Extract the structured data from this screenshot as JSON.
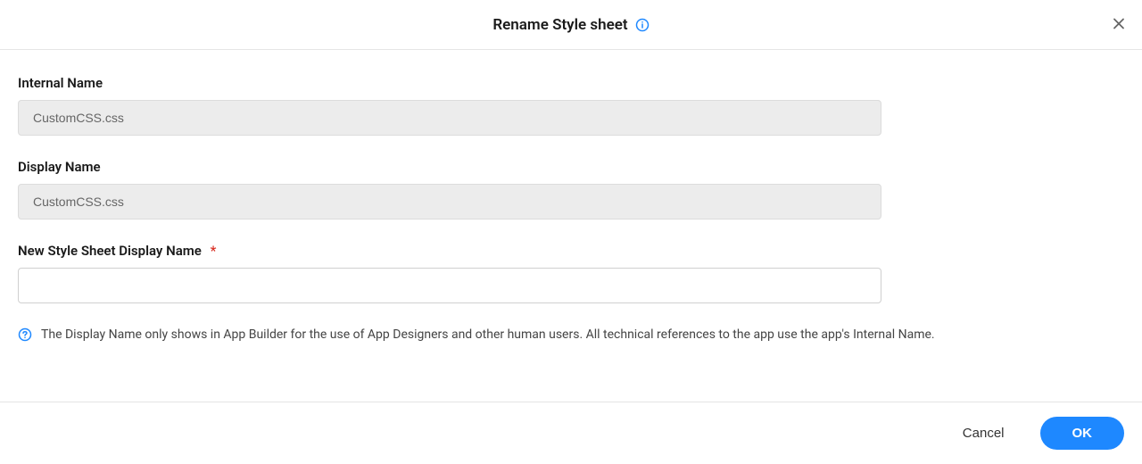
{
  "header": {
    "title": "Rename Style sheet"
  },
  "form": {
    "internal_name": {
      "label": "Internal Name",
      "value": "CustomCSS.css"
    },
    "display_name": {
      "label": "Display Name",
      "value": "CustomCSS.css"
    },
    "new_display_name": {
      "label": "New Style Sheet Display Name",
      "value": ""
    },
    "help_text": "The Display Name only shows in App Builder for the use of App Designers and other human users. All technical references to the app use the app's Internal Name."
  },
  "footer": {
    "cancel_label": "Cancel",
    "ok_label": "OK"
  }
}
